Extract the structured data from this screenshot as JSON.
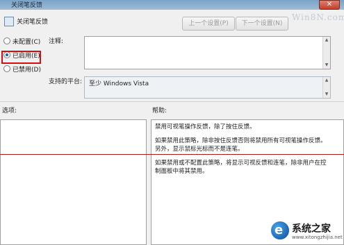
{
  "window": {
    "title": "关闭笔反馈"
  },
  "header": {
    "title": "关闭笔反馈",
    "prev_button": "上一个设置(P)",
    "next_button": "下一个设置(N)",
    "watermark": "Win8N.com"
  },
  "state": {
    "options": [
      {
        "label": "未配置(C)",
        "selected": false
      },
      {
        "label": "已启用(E)",
        "selected": true
      },
      {
        "label": "已禁用(D)",
        "selected": false
      }
    ]
  },
  "comment": {
    "label": "注释:",
    "value": ""
  },
  "platform": {
    "label": "支持的平台:",
    "value": "至少 Windows Vista"
  },
  "sections": {
    "options_label": "选项:",
    "help_label": "帮助:"
  },
  "help": {
    "paragraphs": [
      "禁用可视笔操作反馈，除了按住反馈。",
      "如果禁用此策略，除非按住反馈否则将禁用所有可视笔操作反馈。另外，显示鼠标光标而不是连笔。",
      "如果禁用或不配置此策略，将显示可视反馈和连笔，除非用户在控制面板中将其禁用。"
    ]
  },
  "branding": {
    "name": "系统之家",
    "url": "www.xitongzhijia.net",
    "accent": "#0a4c9a"
  },
  "colors": {
    "highlight": "#d01010",
    "annotation_line": "#b01818"
  }
}
